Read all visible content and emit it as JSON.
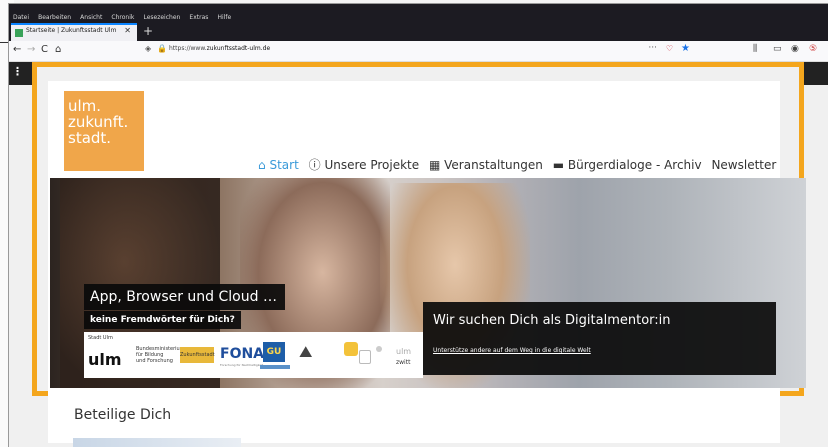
{
  "menubar": {
    "items": [
      "Datei",
      "Bearbeiten",
      "Ansicht",
      "Chronik",
      "Lesezeichen",
      "Extras",
      "Hilfe"
    ]
  },
  "tab": {
    "title": "Startseite | Zukunftsstadt Ulm",
    "close": "✕",
    "new_tab": "+"
  },
  "navbar": {
    "back": "←",
    "forward": "→",
    "reload": "C",
    "home": "⌂",
    "url_prefix": "https://www.",
    "url_domain": "zukunftsstadt-ulm.de",
    "page_actions": "···"
  },
  "site": {
    "logo_text": "ulm.\nzukunft.\nstadt.",
    "nav": [
      {
        "icon": "home-icon",
        "glyph": "⌂",
        "label": "Start"
      },
      {
        "icon": "info-icon",
        "glyph": "ⓘ",
        "label": "Unsere Projekte"
      },
      {
        "icon": "calendar-icon",
        "glyph": "▦",
        "label": "Veranstaltungen"
      },
      {
        "icon": "archive-icon",
        "glyph": "▬",
        "label": "Bürgerdialoge - Archiv"
      },
      {
        "icon": "",
        "glyph": "",
        "label": "Newsletter"
      }
    ],
    "hero_title": "App, Browser und Cloud …",
    "hero_subtitle": "keine Fremdwörter für Dich?",
    "sponsors": {
      "ulm_small": "Stadt Ulm",
      "ulm": "ulm",
      "bmbf": "Bundesministerium\nfür Bildung\nund Forschung",
      "zukunftsstadt": "Zukunftsstadt",
      "fona": "FONA",
      "fona_sub": "Forschung für Nachhaltigkeit",
      "gu": "GU",
      "ulm_gray": "ulm",
      "zwitt": "zwitt"
    },
    "cta_heading": "Wir suchen Dich als Digitalmentor:in",
    "cta_link": "Unterstütze andere auf dem Weg in die digitale Welt",
    "section_title": "Beteilige Dich"
  },
  "colors": {
    "accent": "#f4a61d",
    "nav_active": "#3a9ad9",
    "logo_bg": "#f0a64a"
  }
}
